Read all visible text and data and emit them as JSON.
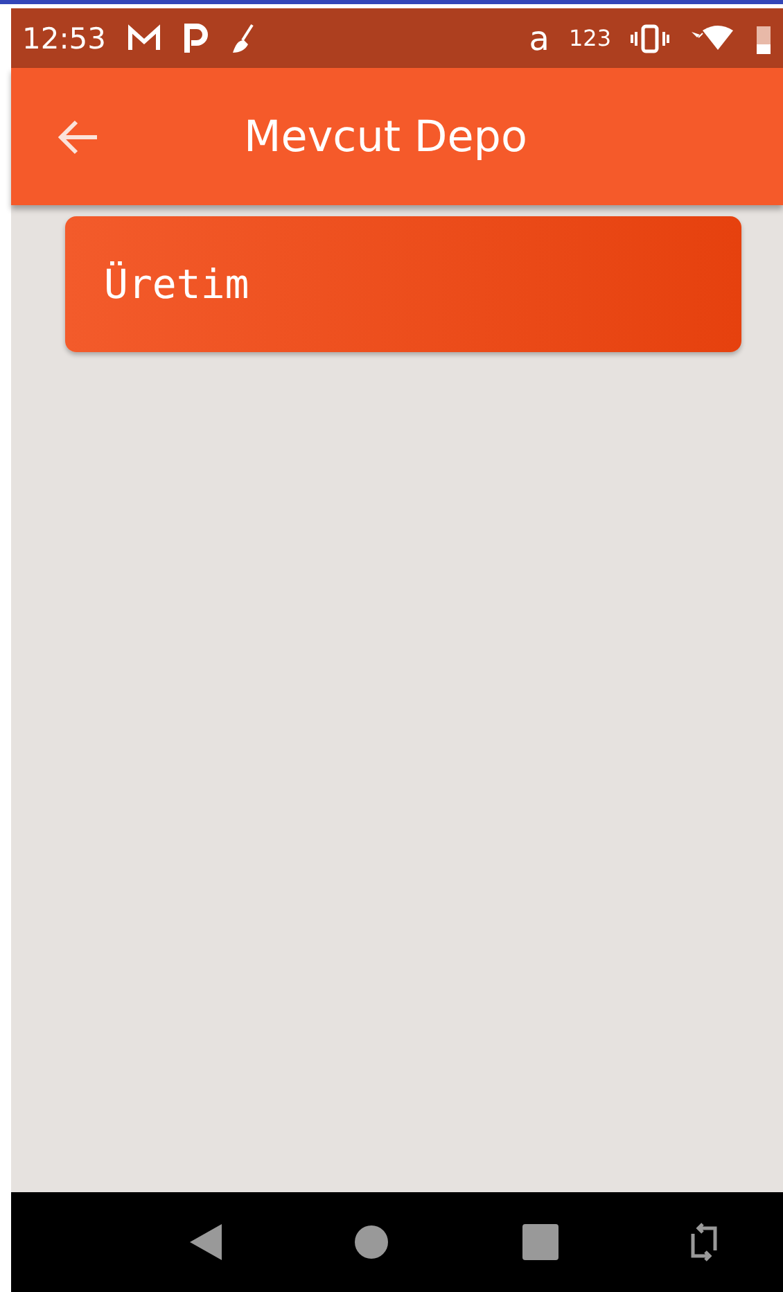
{
  "status_bar": {
    "time": "12:53",
    "indicators": [
      "a",
      "123"
    ]
  },
  "app_bar": {
    "title": "Mevcut Depo"
  },
  "items": [
    {
      "label": "Üretim"
    }
  ]
}
